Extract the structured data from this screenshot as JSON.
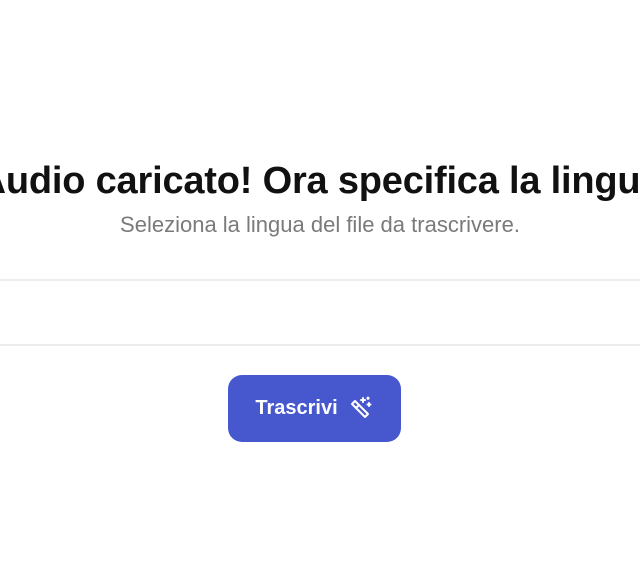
{
  "header": {
    "title": "Audio caricato! Ora specifica la lingua",
    "subtitle": "Seleziona la lingua del file da trascrivere."
  },
  "language_select": {
    "value": ""
  },
  "actions": {
    "transcribe_label": "Trascrivi",
    "transcribe_icon": "magic-wand-icon"
  },
  "colors": {
    "accent": "#4758cf",
    "subtitle": "#7a7a7a",
    "divider": "#ececec"
  }
}
